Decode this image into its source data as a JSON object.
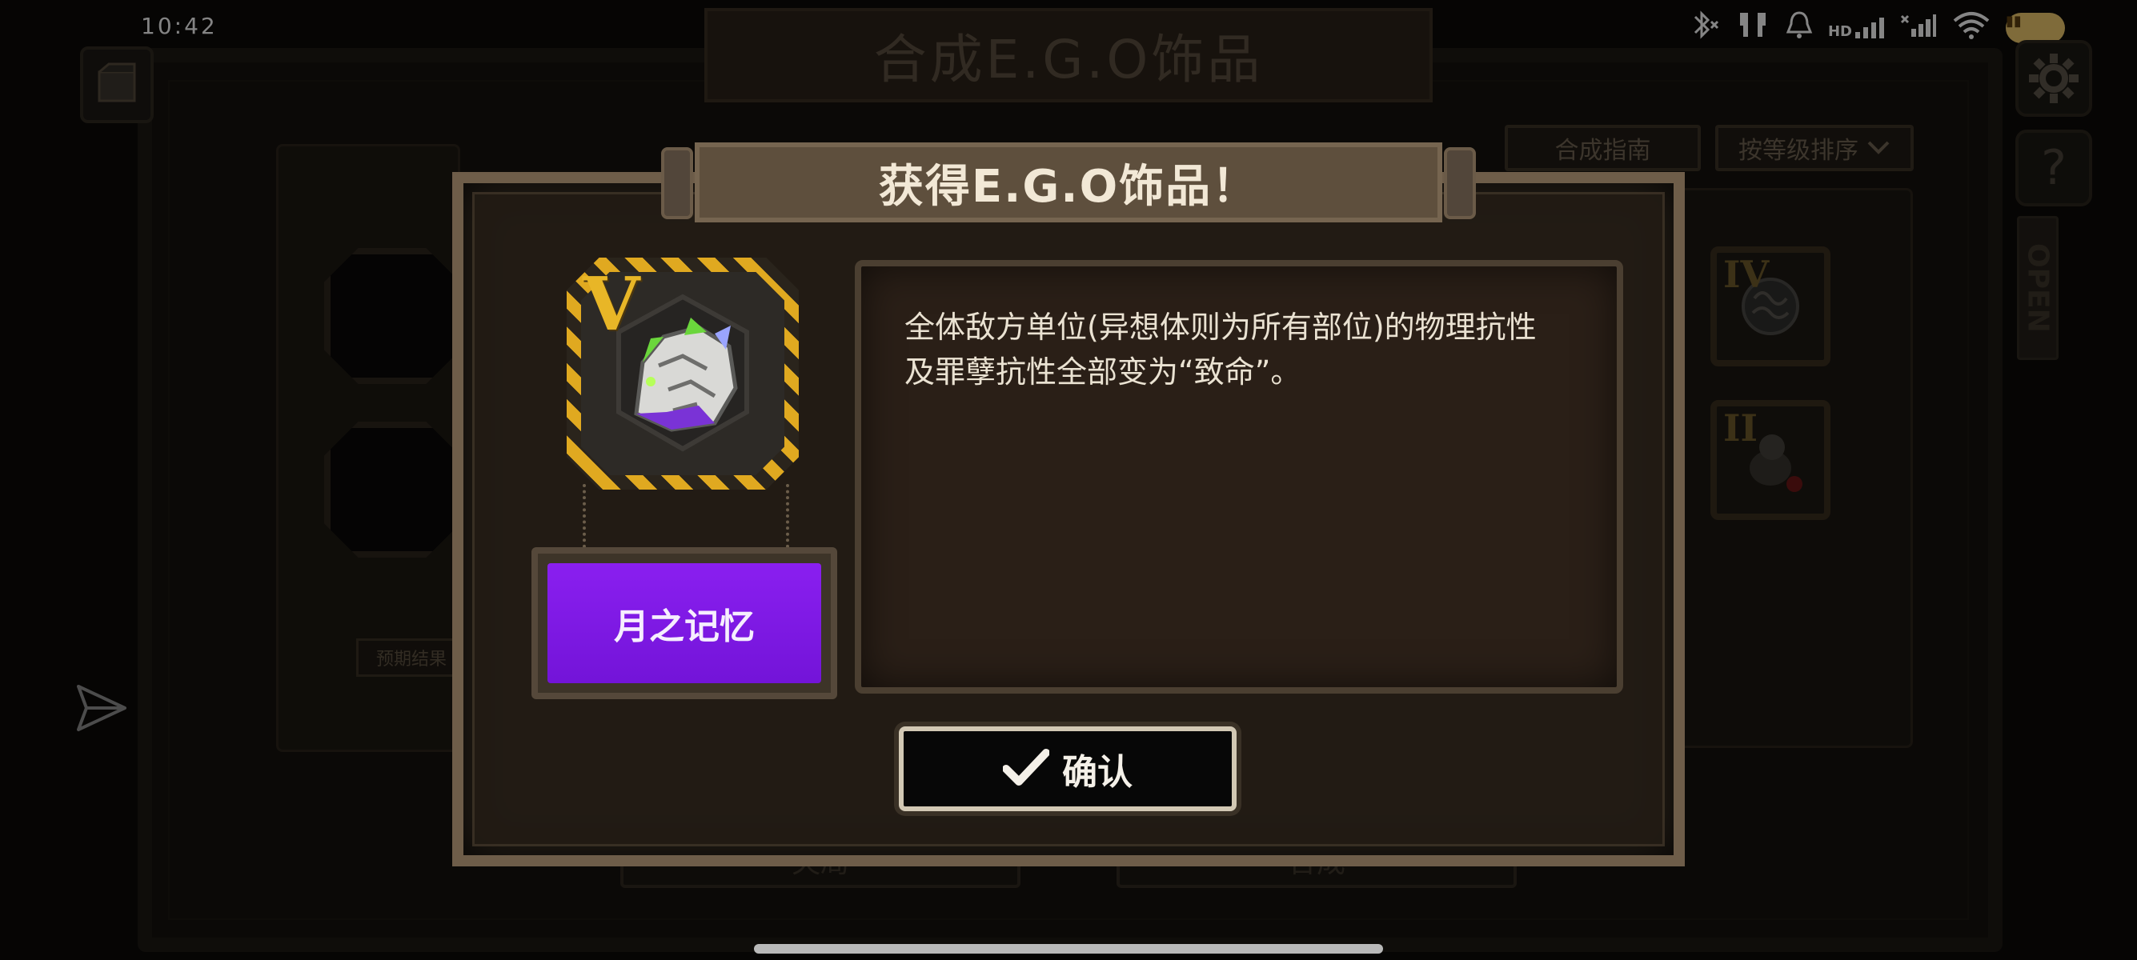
{
  "status_bar": {
    "time": "10:42",
    "icons": [
      "bluetooth-icon",
      "earbuds-icon",
      "bell-icon",
      "hd-signal-icon",
      "signal-icon",
      "wifi-icon",
      "battery-icon"
    ],
    "hd_label": "HD"
  },
  "background": {
    "title": "合成E.G.O饰品",
    "guide_button": "合成指南",
    "sort_button": "按等级排序",
    "expected_result": "预期结果",
    "bottom_left_button": "失局",
    "bottom_right_button": "合成",
    "side_label": "OPEN",
    "item_cards": [
      {
        "rank": "IV"
      },
      {
        "rank": "II"
      }
    ]
  },
  "modal": {
    "title": "获得E.G.O饰品！",
    "item": {
      "rank": "V",
      "name": "月之记忆"
    },
    "description_line1": "全体敌方单位(异想体则为所有部位)的物理抗性",
    "description_line2": "及罪孽抗性全部变为“致命”。",
    "confirm_label": "确认"
  },
  "colors": {
    "accent_gold": "#e0a920",
    "name_purple": "#8a1ff0",
    "frame_brown": "#6e5d49"
  }
}
